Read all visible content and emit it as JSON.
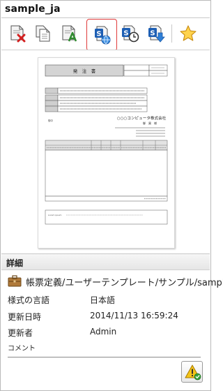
{
  "window": {
    "title": "sample_ja"
  },
  "toolbar": {
    "buttons": [
      {
        "icon": "delete-document-icon"
      },
      {
        "icon": "copy-document-icon"
      },
      {
        "icon": "edit-document-icon"
      },
      {
        "icon": "publish-globe-icon",
        "state": "highlighted"
      },
      {
        "icon": "schedule-clock-icon"
      },
      {
        "icon": "download-arrow-icon"
      },
      {
        "icon": "favorite-star-icon"
      }
    ],
    "highlight_color": "#e03a3a"
  },
  "preview": {
    "doc_title": "発　注　書",
    "company": "○○○コンピュータ株式会社",
    "footer_note": "Lorem ipsum"
  },
  "details": {
    "header": "詳細",
    "path": "帳票定義/ユーザーテンプレート/サンプル/sampl...",
    "rows": [
      {
        "label": "様式の言語",
        "value": "日本語"
      },
      {
        "label": "更新日時",
        "value": "2014/11/13 16:59:24"
      },
      {
        "label": "更新者",
        "value": "Admin"
      }
    ],
    "comment_label": "コメント"
  }
}
